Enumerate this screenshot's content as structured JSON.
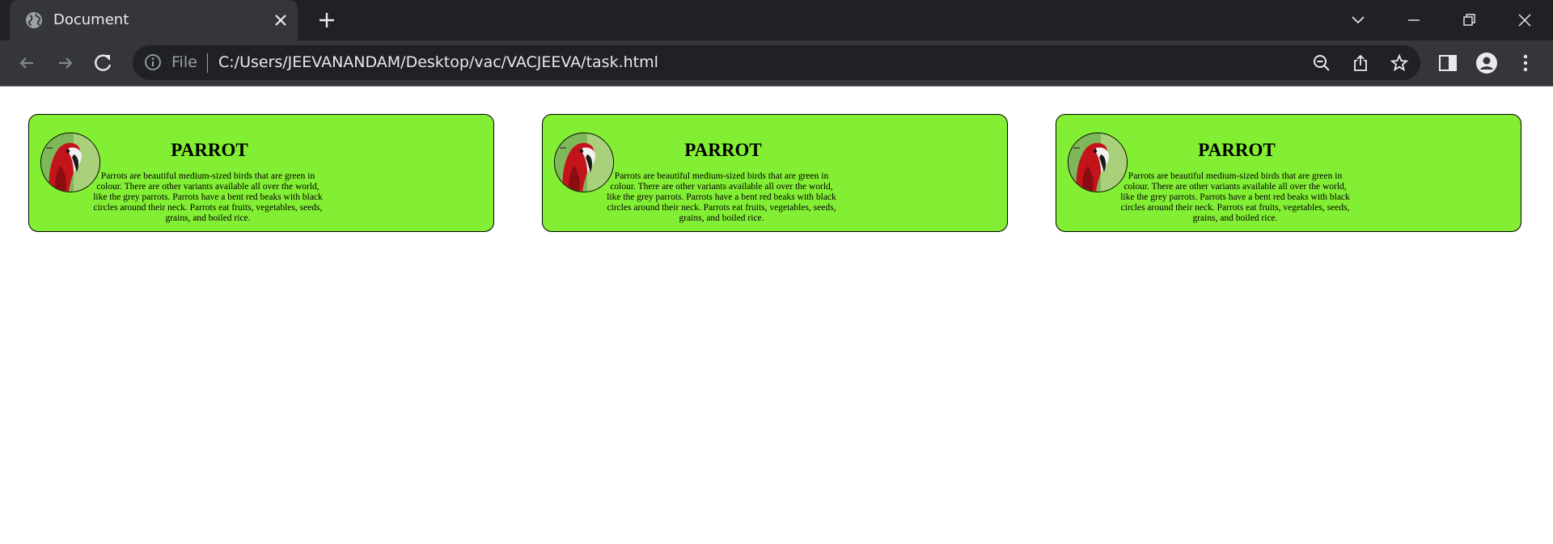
{
  "browser": {
    "tab": {
      "title": "Document"
    },
    "address": {
      "scheme_label": "File",
      "url": "C:/Users/JEEVANANDAM/Desktop/vac/VACJEEVA/task.html"
    },
    "icons": {
      "favicon": "globe-icon",
      "tab_close": "close-icon",
      "new_tab": "plus-icon",
      "tab_search": "chevron-down-icon",
      "minimize": "minimize-icon",
      "restore": "restore-icon",
      "close": "window-close-icon",
      "back": "back-arrow-icon",
      "forward": "forward-arrow-icon",
      "reload": "reload-icon",
      "info": "info-icon",
      "zoom": "zoom-out-icon",
      "share": "share-icon",
      "bookmark": "star-icon",
      "side_panel": "side-panel-icon",
      "profile": "profile-icon",
      "menu": "kebab-menu-icon"
    },
    "colors": {
      "frame": "#202124",
      "toolbar": "#35363a",
      "text": "#e8eaed"
    }
  },
  "page": {
    "colors": {
      "card_background": "#83ef34",
      "card_border": "#000000"
    },
    "cards": [
      {
        "heading": "PARROT",
        "image": "parrot-image",
        "description": "Parrots are beautiful medium-sized birds that are green in colour. There are other variants available all over the world, like the grey parrots. Parrots have a bent red beaks with black circles around their neck. Parrots eat fruits, vegetables, seeds, grains, and boiled rice."
      },
      {
        "heading": "PARROT",
        "image": "parrot-image",
        "description": "Parrots are beautiful medium-sized birds that are green in colour. There are other variants available all over the world, like the grey parrots. Parrots have a bent red beaks with black circles around their neck. Parrots eat fruits, vegetables, seeds, grains, and boiled rice."
      },
      {
        "heading": "PARROT",
        "image": "parrot-image",
        "description": "Parrots are beautiful medium-sized birds that are green in colour. There are other variants available all over the world, like the grey parrots. Parrots have a bent red beaks with black circles around their neck. Parrots eat fruits, vegetables, seeds, grains, and boiled rice."
      }
    ]
  }
}
